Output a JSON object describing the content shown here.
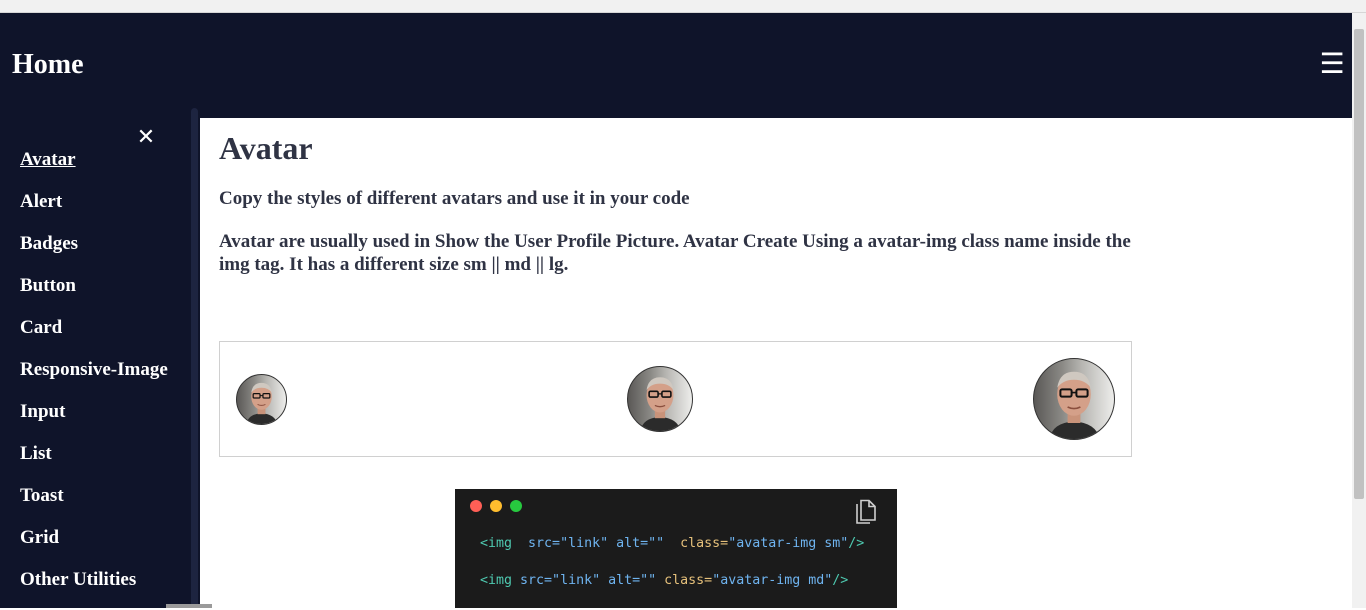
{
  "header": {
    "brand": "Home",
    "menu_icon": "☰"
  },
  "sidebar": {
    "close_icon": "✕",
    "items": [
      {
        "label": "Avatar",
        "active": true
      },
      {
        "label": "Alert"
      },
      {
        "label": "Badges"
      },
      {
        "label": "Button"
      },
      {
        "label": "Card"
      },
      {
        "label": "Responsive-Image"
      },
      {
        "label": "Input"
      },
      {
        "label": "List"
      },
      {
        "label": "Toast"
      },
      {
        "label": "Grid"
      },
      {
        "label": "Other Utilities"
      }
    ]
  },
  "main": {
    "title": "Avatar",
    "subtitle": "Copy the styles of different avatars and use it in your code",
    "description": "Avatar are usually used in Show the User Profile Picture. Avatar Create Using a avatar-img class name inside the img tag. It has a different size sm || md || lg.",
    "avatars": [
      "sm",
      "md",
      "lg"
    ],
    "code": {
      "line1": {
        "open": "<img",
        "attrs": "  src=\"link\" alt=\"\"  ",
        "cls_attr": "class=",
        "cls_val": "\"avatar-img sm\"",
        "close": "/>"
      },
      "line2": {
        "open": "<img",
        "attrs": " src=\"link\" alt=\"\" ",
        "cls_attr": "class=",
        "cls_val": "\"avatar-img md\"",
        "close": "/>"
      }
    }
  },
  "colors": {
    "navy": "#0f142a",
    "text": "#2f3344",
    "code_bg": "#1b1b1b",
    "dot_red": "#ff5f56",
    "dot_yellow": "#ffbd2e",
    "dot_green": "#27c93f"
  }
}
